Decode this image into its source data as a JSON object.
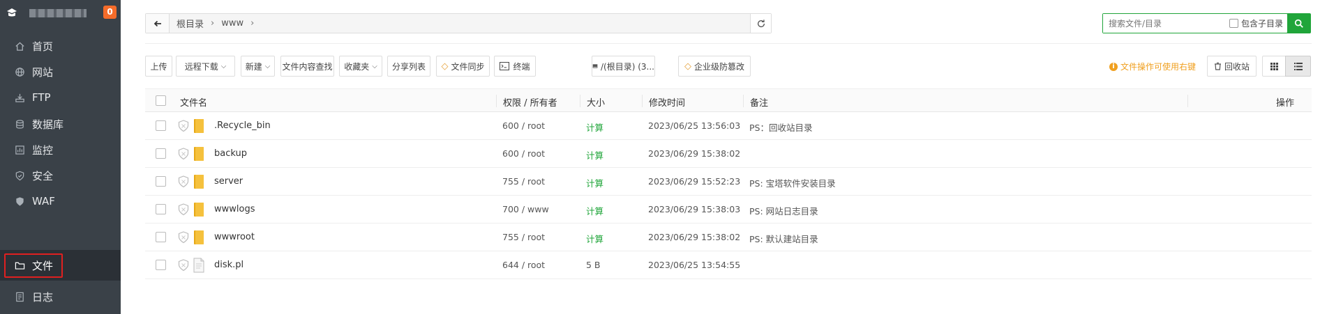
{
  "sidebar": {
    "badge": "0",
    "items": [
      {
        "label": "首页",
        "icon": "home-icon"
      },
      {
        "label": "网站",
        "icon": "globe-icon"
      },
      {
        "label": "FTP",
        "icon": "ftp-icon"
      },
      {
        "label": "数据库",
        "icon": "database-icon"
      },
      {
        "label": "监控",
        "icon": "monitor-icon"
      },
      {
        "label": "安全",
        "icon": "shield-check-icon"
      },
      {
        "label": "WAF",
        "icon": "waf-shield-icon"
      },
      {
        "label": "文件",
        "icon": "folder-icon",
        "active": true
      },
      {
        "label": "日志",
        "icon": "log-icon"
      }
    ]
  },
  "pathbar": {
    "crumbs": [
      "根目录",
      "www"
    ]
  },
  "search": {
    "placeholder": "搜索文件/目录",
    "include_sub": "包含子目录"
  },
  "toolbar": {
    "upload": "上传",
    "remote_download": "远程下载",
    "new": "新建",
    "content_search": "文件内容查找",
    "favorites": "收藏夹",
    "share_list": "分享列表",
    "file_sync": "文件同步",
    "terminal": "终端",
    "disk": "/(根目录) (3...",
    "tamper": "企业级防篡改",
    "tip": "文件操作可使用右键",
    "recycle": "回收站"
  },
  "table": {
    "headers": {
      "name": "文件名",
      "perm": "权限 / 所有者",
      "size": "大小",
      "mtime": "修改时间",
      "note": "备注",
      "ops": "操作"
    },
    "rows": [
      {
        "name": ".Recycle_bin",
        "type": "folder",
        "perm": "600 / root",
        "size": "计算",
        "mtime": "2023/06/25 13:56:03",
        "note": "PS：回收站目录"
      },
      {
        "name": "backup",
        "type": "folder",
        "perm": "600 / root",
        "size": "计算",
        "mtime": "2023/06/29 15:38:02",
        "note": ""
      },
      {
        "name": "server",
        "type": "folder",
        "perm": "755 / root",
        "size": "计算",
        "mtime": "2023/06/29 15:52:23",
        "note": "PS: 宝塔软件安装目录"
      },
      {
        "name": "wwwlogs",
        "type": "folder",
        "perm": "700 / www",
        "size": "计算",
        "mtime": "2023/06/29 15:38:03",
        "note": "PS: 网站日志目录"
      },
      {
        "name": "wwwroot",
        "type": "folder",
        "perm": "755 / root",
        "size": "计算",
        "mtime": "2023/06/29 15:38:02",
        "note": "PS: 默认建站目录"
      },
      {
        "name": "disk.pl",
        "type": "file",
        "perm": "644 / root",
        "size": "5 B",
        "mtime": "2023/06/25 13:54:55",
        "note": ""
      }
    ]
  },
  "colors": {
    "accent": "#20a53a",
    "sidebar_bg": "#3a4148",
    "badge": "#f56c2a",
    "warning": "#f0a020",
    "folder": "#f5c13d"
  }
}
